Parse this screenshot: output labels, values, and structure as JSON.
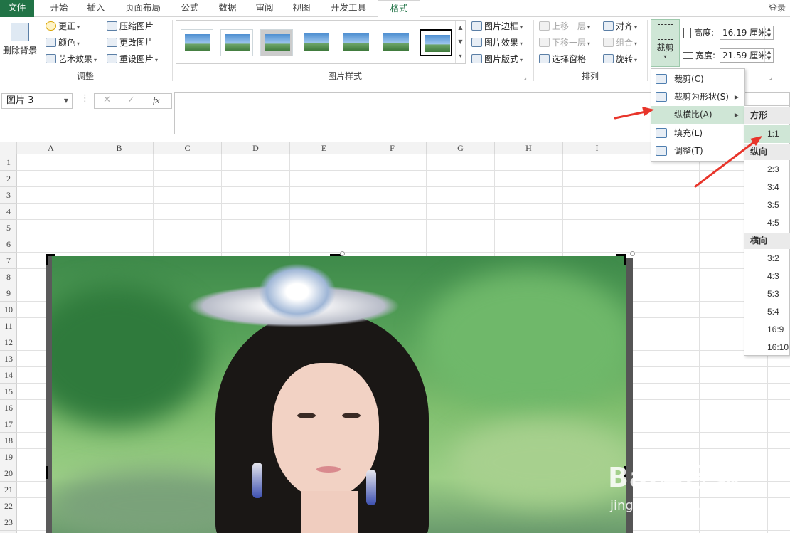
{
  "tabs": [
    {
      "label": "文件"
    },
    {
      "label": "开始"
    },
    {
      "label": "插入"
    },
    {
      "label": "页面布局"
    },
    {
      "label": "公式"
    },
    {
      "label": "数据"
    },
    {
      "label": "审阅"
    },
    {
      "label": "视图"
    },
    {
      "label": "开发工具"
    },
    {
      "label": "格式"
    }
  ],
  "account": "登录",
  "ribbon": {
    "remove_bg": "删除背景",
    "adjust": {
      "label": "调整",
      "correct": "更正",
      "color": "颜色",
      "artistic": "艺术效果",
      "compress": "压缩图片",
      "change": "更改图片",
      "reset": "重设图片"
    },
    "styles": {
      "label": "图片样式",
      "border": "图片边框",
      "effects": "图片效果",
      "layout": "图片版式"
    },
    "arrange": {
      "label": "排列",
      "forward": "上移一层",
      "backward": "下移一层",
      "pane": "选择窗格",
      "align": "对齐",
      "group": "组合",
      "rotate": "旋转"
    },
    "size": {
      "crop": "裁剪",
      "height_label": "高度:",
      "height_value": "16.19 厘米",
      "width_label": "宽度:",
      "width_value": "21.59 厘米"
    }
  },
  "formula_bar": {
    "name_box": "图片 3",
    "cancel": "✕",
    "enter": "✓",
    "fx": "fx"
  },
  "columns": [
    "A",
    "B",
    "C",
    "D",
    "E",
    "F",
    "G",
    "H",
    "I"
  ],
  "rows": [
    "1",
    "2",
    "3",
    "4",
    "5",
    "6",
    "7",
    "8",
    "9",
    "10",
    "11",
    "12",
    "13",
    "14",
    "15",
    "16",
    "17",
    "18",
    "19",
    "20",
    "21",
    "22",
    "23"
  ],
  "crop_menu": {
    "crop": "裁剪(C)",
    "crop_to_shape": "裁剪为形状(S)",
    "aspect_ratio": "纵横比(A)",
    "fill": "填充(L)",
    "fit": "调整(T)"
  },
  "aspect_menu": {
    "square_header": "方形",
    "square": [
      "1:1"
    ],
    "portrait_header": "纵向",
    "portrait": [
      "2:3",
      "3:4",
      "3:5",
      "4:5"
    ],
    "landscape_header": "横向",
    "landscape": [
      "3:2",
      "4:3",
      "5:3",
      "5:4",
      "16:9",
      "16:10"
    ]
  },
  "watermark": {
    "brand": "Bai度经验",
    "url": "jingyan.baidu.com"
  },
  "colors": {
    "accent": "#217346",
    "highlight": "#cfe6d6",
    "annotation": "#e8352b"
  }
}
